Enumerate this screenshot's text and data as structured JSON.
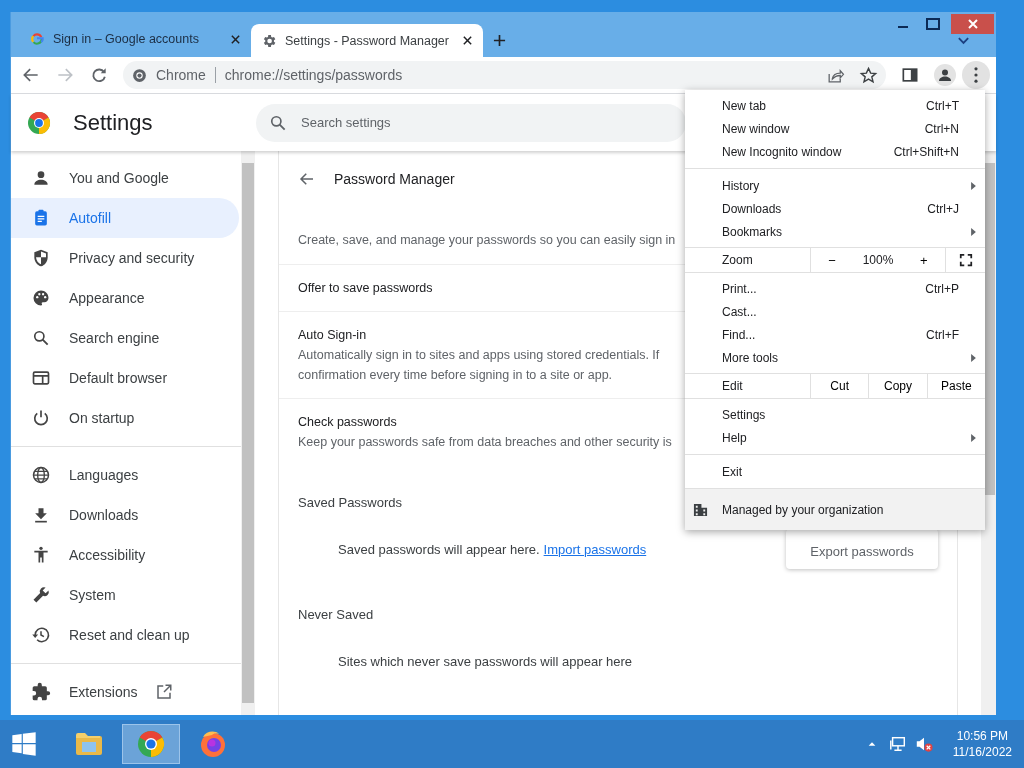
{
  "tabs": [
    {
      "title": "Sign in – Google accounts",
      "selected": false
    },
    {
      "title": "Settings - Password Manager",
      "selected": true
    }
  ],
  "address_bar": {
    "site_label": "Chrome",
    "url": "chrome://settings/passwords"
  },
  "header": {
    "title": "Settings",
    "search": {
      "placeholder": "Search settings"
    }
  },
  "sidebar": {
    "groups": [
      {
        "items": [
          {
            "label": "You and Google",
            "selected": false
          },
          {
            "label": "Autofill",
            "selected": true
          },
          {
            "label": "Privacy and security",
            "selected": false
          },
          {
            "label": "Appearance",
            "selected": false
          },
          {
            "label": "Search engine",
            "selected": false
          },
          {
            "label": "Default browser",
            "selected": false
          },
          {
            "label": "On startup",
            "selected": false
          }
        ]
      },
      {
        "items": [
          {
            "label": "Languages",
            "selected": false
          },
          {
            "label": "Downloads",
            "selected": false
          },
          {
            "label": "Accessibility",
            "selected": false
          },
          {
            "label": "System",
            "selected": false
          },
          {
            "label": "Reset and clean up",
            "selected": false
          }
        ]
      },
      {
        "items": [
          {
            "label": "Extensions",
            "selected": false,
            "external": true
          }
        ]
      }
    ]
  },
  "page": {
    "title": "Password Manager",
    "intro": "Create, save, and manage your passwords so you can easily sign in",
    "rows": [
      {
        "title": "Offer to save passwords"
      },
      {
        "title": "Auto Sign-in",
        "description": [
          "Automatically sign in to sites and apps using stored credentials. If",
          "confirmation every time before signing in to a site or app."
        ]
      },
      {
        "title": "Check passwords",
        "description": [
          "Keep your passwords safe from data breaches and other security is"
        ]
      }
    ],
    "sections": [
      {
        "title": "Saved Passwords",
        "empty_text": "Saved passwords will appear here.",
        "link": "Import passwords"
      },
      {
        "title": "Never Saved",
        "empty_text": "Sites which never save passwords will appear here"
      }
    ],
    "export_button": "Export passwords"
  },
  "menu": {
    "items": [
      {
        "kind": "item",
        "label": "New tab",
        "shortcut": "Ctrl+T",
        "submenu": false
      },
      {
        "kind": "item",
        "label": "New window",
        "shortcut": "Ctrl+N",
        "submenu": false
      },
      {
        "kind": "item",
        "label": "New Incognito window",
        "shortcut": "Ctrl+Shift+N",
        "submenu": false
      },
      {
        "kind": "separator"
      },
      {
        "kind": "item",
        "label": "History",
        "submenu": true
      },
      {
        "kind": "item",
        "label": "Downloads",
        "shortcut": "Ctrl+J",
        "submenu": false
      },
      {
        "kind": "item",
        "label": "Bookmarks",
        "submenu": true
      },
      {
        "kind": "zoom",
        "label": "Zoom",
        "minus": "−",
        "value": "100%",
        "plus": "+"
      },
      {
        "kind": "item",
        "label": "Print...",
        "shortcut": "Ctrl+P",
        "submenu": false
      },
      {
        "kind": "item",
        "label": "Cast...",
        "submenu": false
      },
      {
        "kind": "item",
        "label": "Find...",
        "shortcut": "Ctrl+F",
        "submenu": false
      },
      {
        "kind": "item",
        "label": "More tools",
        "submenu": true
      },
      {
        "kind": "edit",
        "label": "Edit",
        "buttons": [
          "Cut",
          "Copy",
          "Paste"
        ]
      },
      {
        "kind": "item",
        "label": "Settings",
        "submenu": false
      },
      {
        "kind": "item",
        "label": "Help",
        "submenu": true
      },
      {
        "kind": "separator"
      },
      {
        "kind": "item",
        "label": "Exit",
        "submenu": false
      },
      {
        "kind": "managed",
        "label": "Managed by your organization"
      }
    ]
  },
  "taskbar": {
    "apps": [
      {
        "kind": "explorer",
        "selected": false
      },
      {
        "kind": "chrome",
        "selected": true
      },
      {
        "kind": "firefox",
        "selected": false
      }
    ],
    "time": "10:56 PM",
    "date": "11/16/2022"
  }
}
